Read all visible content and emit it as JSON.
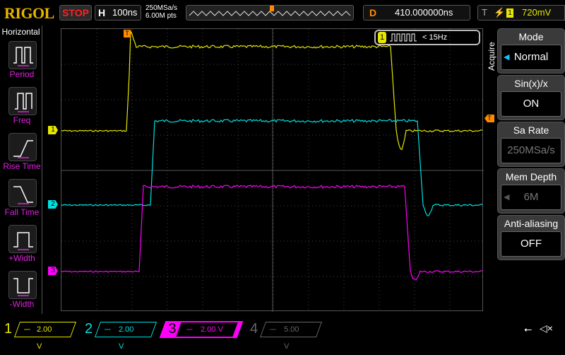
{
  "header": {
    "logo": "RIGOL",
    "run_state": "STOP",
    "h_label": "H",
    "timebase": "100ns",
    "sample_rate": "250MSa/s",
    "mem_points": "6.00M pts",
    "d_label": "D",
    "delay": "410.000000ns",
    "t_label": "T",
    "trigger_source": "1",
    "trigger_level": "720mV"
  },
  "left_menu": {
    "title": "Horizontal",
    "items": [
      {
        "label": "Period",
        "icon": "period-icon"
      },
      {
        "label": "Freq",
        "icon": "freq-icon"
      },
      {
        "label": "Rise Time",
        "icon": "rise-time-icon"
      },
      {
        "label": "Fall Time",
        "icon": "fall-time-icon"
      },
      {
        "label": "+Width",
        "icon": "plus-width-icon"
      },
      {
        "label": "-Width",
        "icon": "minus-width-icon"
      }
    ]
  },
  "measurement": {
    "channel": "1",
    "value": "< 15Hz"
  },
  "right_menu": {
    "title": "Acquire",
    "items": [
      {
        "label": "Mode",
        "value": "Normal"
      },
      {
        "label": "Sin(x)/x",
        "value": "ON"
      },
      {
        "label": "Sa Rate",
        "value": "250MSa/s"
      },
      {
        "label": "Mem Depth",
        "value": "6M"
      },
      {
        "label": "Anti-aliasing",
        "value": "OFF"
      }
    ]
  },
  "channels": [
    {
      "num": "1",
      "scale": "2.00 V",
      "color": "#e6e600"
    },
    {
      "num": "2",
      "scale": "2.00 V",
      "color": "#00e0e0"
    },
    {
      "num": "3",
      "scale": "2.00 V",
      "color": "#ff00ff"
    },
    {
      "num": "4",
      "scale": "5.00 V",
      "color": "#666666"
    }
  ],
  "markers": {
    "trigger": "T"
  }
}
